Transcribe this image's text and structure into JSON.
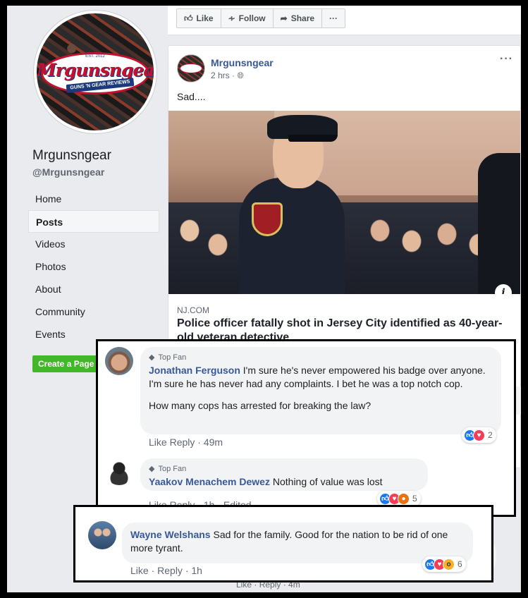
{
  "page": {
    "name": "Mrgunsngear",
    "handle": "@Mrgunsngear",
    "logo": {
      "est": "EST. 2012",
      "name": "Mrgunsngear",
      "tagline": "GUNS 'N GEAR REVIEWS"
    }
  },
  "nav": [
    "Home",
    "Posts",
    "Videos",
    "Photos",
    "About",
    "Community",
    "Events"
  ],
  "nav_active": "Posts",
  "create_page_label": "Create a Page",
  "actionbar": {
    "like": "Like",
    "follow": "Follow",
    "share": "Share",
    "more": "···"
  },
  "post": {
    "author": "Mrgunsngear",
    "time": "2 hrs ·",
    "text": "Sad....",
    "more": "···",
    "link": {
      "domain": "NJ.COM",
      "title": "Police officer fatally shot in Jersey City identified as 40-year-old veteran detective"
    }
  },
  "comments": [
    {
      "badge": "Top Fan",
      "name": "Jonathan Ferguson",
      "text": "I'm sure he's never empowered his badge over anyone. I'm sure he has never had any complaints. I bet he was a top notch cop.",
      "text2": "How many cops has arrested for breaking the law?",
      "like": "Like",
      "reply": "Reply",
      "time": "49m",
      "reaction_count": "2"
    },
    {
      "badge": "Top Fan",
      "name": "Yaakov Menachem Dewez",
      "text": "Nothing of value was lost",
      "like": "Like",
      "reply": "Reply",
      "time": "1h",
      "edited": "Edited",
      "reaction_count": "5"
    },
    {
      "name": "Wayne Welshans",
      "text": "Sad for the family. Good for the nation to be rid of one more tyrant.",
      "like": "Like",
      "reply": "Reply",
      "time": "1h",
      "reaction_count": "6"
    }
  ],
  "background_comment": {
    "like": "Like",
    "reply": "Reply",
    "time": "4m"
  },
  "colors": {
    "link_blue": "#385898",
    "bg": "#e9ebee",
    "create_green": "#42b72a",
    "like_blue": "#1877f2",
    "love_red": "#f33e58"
  }
}
